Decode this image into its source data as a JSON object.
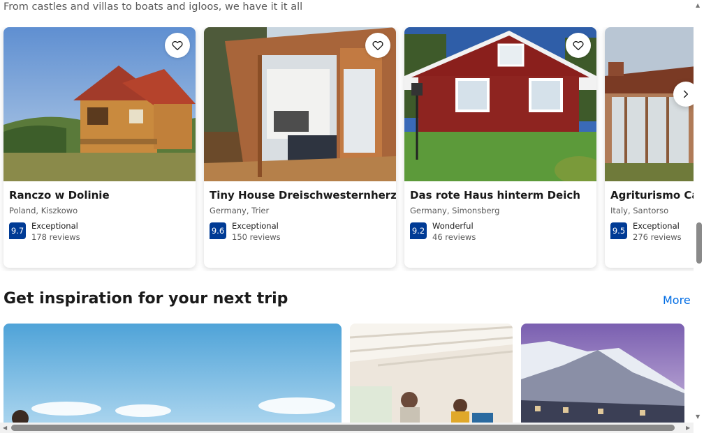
{
  "subtitle": "From castles and villas to boats and igloos, we have it it all",
  "properties": [
    {
      "name": "Ranczo w Dolinie",
      "location": "Poland, Kiszkowo",
      "score": "9.7",
      "rating_word": "Exceptional",
      "reviews": "178 reviews"
    },
    {
      "name": "Tiny House Dreischwesternherz",
      "location": "Germany, Trier",
      "score": "9.6",
      "rating_word": "Exceptional",
      "reviews": "150 reviews"
    },
    {
      "name": "Das rote Haus hinterm Deich",
      "location": "Germany, Simonsberg",
      "score": "9.2",
      "rating_word": "Wonderful",
      "reviews": "46 reviews"
    },
    {
      "name": "Agriturismo Cab",
      "location": "Italy, Santorso",
      "score": "9.5",
      "rating_word": "Exceptional",
      "reviews": "276 reviews"
    }
  ],
  "section": {
    "title": "Get inspiration for your next trip",
    "more_label": "More"
  },
  "icons": {
    "save": "heart-icon",
    "next": "chevron-right-icon"
  },
  "colors": {
    "score_badge": "#003b95",
    "link": "#006ce4"
  }
}
